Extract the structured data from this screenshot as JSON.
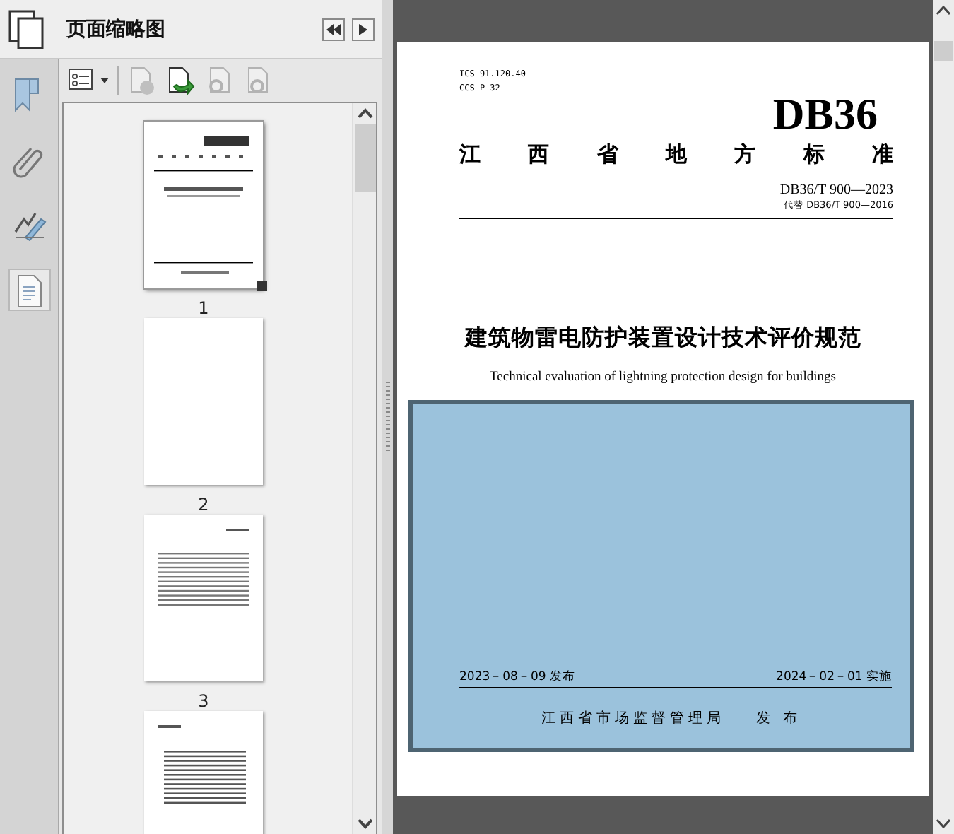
{
  "panel": {
    "title": "页面缩略图"
  },
  "side_tabs": [
    {
      "kind": "bookmark",
      "selected": false
    },
    {
      "kind": "attachment",
      "selected": false
    },
    {
      "kind": "signature",
      "selected": false
    },
    {
      "kind": "pages",
      "selected": true
    }
  ],
  "toolbar": [
    {
      "kind": "options",
      "disabled": false
    },
    {
      "kind": "delete",
      "disabled": true
    },
    {
      "kind": "insert",
      "disabled": false
    },
    {
      "kind": "undo",
      "disabled": true
    },
    {
      "kind": "redo",
      "disabled": true
    }
  ],
  "thumbnails": [
    {
      "label": "1",
      "kind": "cover",
      "selected": true
    },
    {
      "label": "2",
      "kind": "blank",
      "selected": false
    },
    {
      "label": "3",
      "kind": "contents",
      "selected": false
    },
    {
      "kind": "text",
      "selected": false
    }
  ],
  "document": {
    "codes": [
      "ICS 91.120.40",
      "CCS P 32"
    ],
    "logo": "DB36",
    "category": [
      "江",
      "西",
      "省",
      "地",
      "方",
      "标",
      "准"
    ],
    "number": "DB36/T 900—2023",
    "replaces": "代替 DB36/T 900—2016",
    "title": "建筑物雷电防护装置设计技术评价规范",
    "title_en": "Technical evaluation of lightning protection design for buildings",
    "issue_date": "2023－08－09 发布",
    "effective_date": "2024－02－01 实施",
    "issuer": "江西省市场监督管理局",
    "issuer_action": "发 布"
  }
}
